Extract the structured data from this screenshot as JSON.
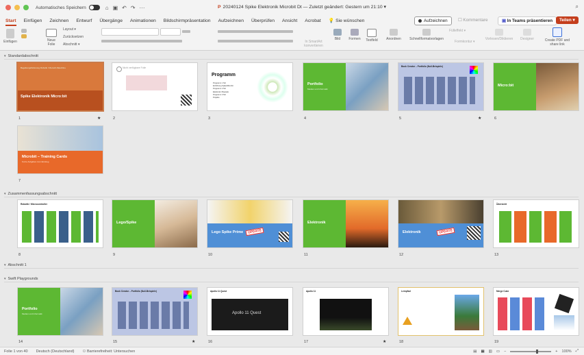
{
  "window": {
    "autosave_label": "Automatisches Speichern",
    "doc_title": "20240124 Spike Elektronik Microbit Dt — Zuletzt geändert: Gestern um 21:10 ▾",
    "search_glyph": "⌕"
  },
  "tabs": [
    "Start",
    "Einfügen",
    "Zeichnen",
    "Entwurf",
    "Übergänge",
    "Animationen",
    "Bildschirmpräsentation",
    "Aufzeichnen",
    "Überprüfen",
    "Ansicht",
    "Acrobat",
    "Sie wünschen"
  ],
  "header_buttons": {
    "record": "Aufzeichnen",
    "comments": "Kommentare",
    "teams": "In Teams präsentieren",
    "share": "Teilen ▾"
  },
  "ribbon": {
    "paste": "Einfügen",
    "new_slide": "Neue Folie",
    "layout": "Layout ▾",
    "reset": "Zurücksetzen",
    "section": "Abschnitt ▾",
    "smartart": "In SmartArt konvertieren",
    "picture": "Bild",
    "shapes": "Formen",
    "textbox": "Textfeld",
    "arrange": "Anordnen",
    "quick_styles": "Schnellformatvorlagen",
    "fill": "Fülleffekt ▾",
    "outline": "Formkontur ▾",
    "dictate": "Vorlesen/Diktieren",
    "designer": "Designer",
    "create_pdf": "Create PDF and share link"
  },
  "sections": [
    {
      "name": "Standardabschnitt"
    },
    {
      "name": "Zusammenfassungsabschnitt"
    },
    {
      "name": "Abschnitt 1"
    },
    {
      "name": "Swift Playgrounds"
    }
  ],
  "slides": {
    "s1": {
      "num": "1",
      "title": "Spike Elektronik Micro:bit",
      "sub": "Begabungsförderung Robotik / Mensch-Maschine"
    },
    "s2": {
      "num": "2",
      "title": "Nicht verfügbare Folie"
    },
    "s3": {
      "num": "3",
      "title": "Programm",
      "lines": [
        "Programm 1 Teil",
        "Einführung Spike/Microbit",
        "Programm 2 Teil",
        "Elektronik / Bauteile",
        "Programm 3 Teil",
        "Projekte"
      ]
    },
    "s4": {
      "num": "4",
      "title": "Portfolio",
      "sub": "Medien und Informatik"
    },
    "s5": {
      "num": "5",
      "title": "Book Creator – Portfolio (Null-Beispiele)"
    },
    "s6": {
      "num": "6",
      "title": "Micro:bit"
    },
    "s7": {
      "num": "7",
      "title": "Microbit – Training Cards",
      "sub": "Kurze Aufgaben zum Einstieg"
    },
    "s8": {
      "num": "8",
      "title": "Robotik / Microcontroller"
    },
    "s9": {
      "num": "9",
      "title": "Lego/Spike"
    },
    "s10": {
      "num": "10",
      "title": "Lego Spike Prime",
      "stamp": "UPDATE"
    },
    "s11": {
      "num": "11",
      "title": "Elektronik"
    },
    "s12": {
      "num": "12",
      "title": "Elektronik",
      "stamp": "UPDATE"
    },
    "s13": {
      "num": "13",
      "title": "Übersicht"
    },
    "s14": {
      "num": "14",
      "title": "Portfolio",
      "sub": "Medien und Informatik"
    },
    "s15": {
      "num": "15",
      "title": "Book Creator – Portfolio (Null-Beispiele)"
    },
    "s16": {
      "num": "16",
      "title": "Apollo 11 Quest",
      "logo": "Apollo 11 Quest"
    },
    "s17": {
      "num": "17",
      "title": "Apollo 11"
    },
    "s18": {
      "num": "18",
      "title": "Lernpfad"
    },
    "s19": {
      "num": "19",
      "title": "Merge Cube"
    }
  },
  "status": {
    "slide_count": "Folie 1 von 40",
    "language": "Deutsch (Deutschland)",
    "accessibility": "Barrierefreiheit: Untersuchen",
    "zoom": "100%"
  },
  "colors": {
    "accent": "#c43e1c",
    "green": "#5db833",
    "orange": "#e8692a"
  }
}
